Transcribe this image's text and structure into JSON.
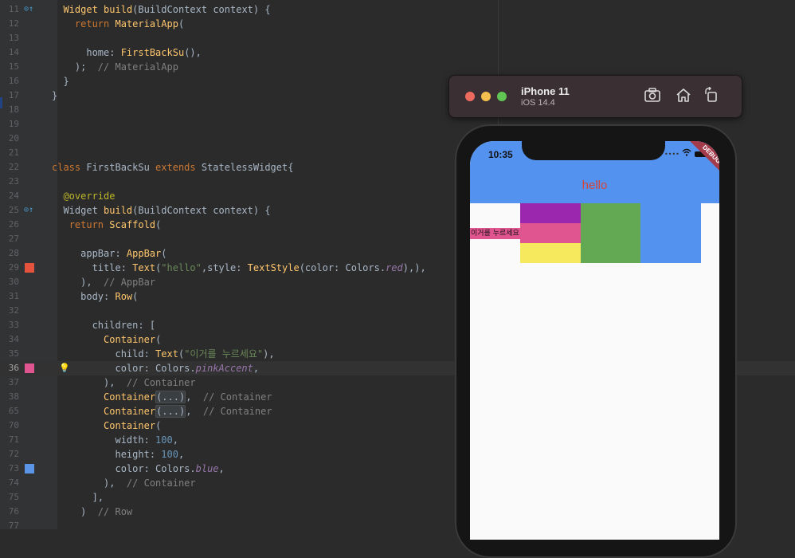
{
  "editor": {
    "lines": [
      {
        "num": "11",
        "html": "  <span class=\"f\">Widget</span> <span class=\"f\">build</span>(BuildContext context) {"
      },
      {
        "num": "12",
        "html": "    <span class=\"k\">return</span> <span class=\"f\">MaterialApp</span>("
      },
      {
        "num": "13",
        "html": ""
      },
      {
        "num": "14",
        "html": "      home: <span class=\"f\">FirstBackSu</span>(),"
      },
      {
        "num": "15",
        "html": "    );  <span class=\"c\">// MaterialApp</span>"
      },
      {
        "num": "16",
        "html": "  }"
      },
      {
        "num": "17",
        "html": "}"
      },
      {
        "num": "18",
        "html": ""
      },
      {
        "num": "19",
        "html": ""
      },
      {
        "num": "20",
        "html": ""
      },
      {
        "num": "21",
        "html": ""
      },
      {
        "num": "22",
        "html": "<span class=\"k\">class</span> FirstBackSu <span class=\"k\">extends</span> StatelessWidget{"
      },
      {
        "num": "23",
        "html": ""
      },
      {
        "num": "24",
        "html": "  <span class=\"a\">@override</span>"
      },
      {
        "num": "25",
        "html": "  Widget <span class=\"f\">build</span>(BuildContext context) {"
      },
      {
        "num": "26",
        "html": "   <span class=\"k\">return</span> <span class=\"f\">Scaffold</span>("
      },
      {
        "num": "27",
        "html": ""
      },
      {
        "num": "28",
        "html": "     appBar: <span class=\"f\">AppBar</span>("
      },
      {
        "num": "29",
        "html": "       title: <span class=\"f\">Text</span>(<span class=\"s\">\"hello\"</span>,style: <span class=\"f\">TextStyle</span>(color: Colors.<span class=\"it\">red</span>),),"
      },
      {
        "num": "30",
        "html": "     ),  <span class=\"c\">// AppBar</span>"
      },
      {
        "num": "31",
        "html": "     body: <span class=\"f\">Row</span>("
      },
      {
        "num": "32",
        "html": ""
      },
      {
        "num": "33",
        "html": "       children: ["
      },
      {
        "num": "34",
        "html": "         <span class=\"f\">Container</span>("
      },
      {
        "num": "35",
        "html": "           child: <span class=\"f\">Text</span>(<span class=\"s\">\"이거를 누르세요\"</span>),"
      },
      {
        "num": "36",
        "html": "           color: Colors.<span class=\"it\">pinkAccent</span>,"
      },
      {
        "num": "37",
        "html": "         ),  <span class=\"c\">// Container</span>"
      },
      {
        "num": "38",
        "html": "         <span class=\"f\">Container</span><span class=\"fold\">(...)</span>,  <span class=\"c\">// Container</span>"
      },
      {
        "num": "65",
        "html": "         <span class=\"f\">Container</span><span class=\"fold\">(...)</span>,  <span class=\"c\">// Container</span>"
      },
      {
        "num": "70",
        "html": "         <span class=\"f\">Container</span>("
      },
      {
        "num": "71",
        "html": "           width: <span class=\"n\">100</span>,"
      },
      {
        "num": "72",
        "html": "           height: <span class=\"n\">100</span>,"
      },
      {
        "num": "73",
        "html": "           color: Colors.<span class=\"it\">blue</span>,"
      },
      {
        "num": "74",
        "html": "         ),  <span class=\"c\">// Container</span>"
      },
      {
        "num": "75",
        "html": "       ],"
      },
      {
        "num": "76",
        "html": "     )  <span class=\"c\">// Row</span>"
      },
      {
        "num": "77",
        "html": ""
      }
    ],
    "current_line": "36",
    "swatches": {
      "29": "#e5533f",
      "36": "#e05490",
      "73": "#5a95e8"
    }
  },
  "simulator": {
    "device": "iPhone 11",
    "os": "iOS 14.4",
    "icons": [
      "screenshot-icon",
      "home-icon",
      "rotate-icon"
    ]
  },
  "app": {
    "status_time": "10:35",
    "debug_banner": "DEBUG",
    "appbar_title": "hello",
    "appbar_color": "#5393ef",
    "title_color": "#d4453c",
    "pink_text": "이거를 누르세요",
    "column_colors": [
      "#9b27af",
      "#e05490",
      "#f7e95e"
    ],
    "green_color": "#63a852",
    "blue_color": "#5393ef"
  }
}
